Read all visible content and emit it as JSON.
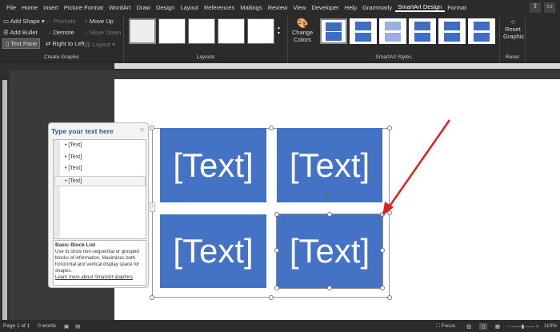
{
  "tabs": [
    "File",
    "Home",
    "Insert",
    "Picture Format",
    "WordArt",
    "Draw",
    "Design",
    "Layout",
    "References",
    "Mailings",
    "Review",
    "View",
    "Developer",
    "Help",
    "Grammarly",
    "SmartArt Design",
    "Format"
  ],
  "active_tab": "SmartArt Design",
  "create_graphic": {
    "label": "Create Graphic",
    "add_shape": "Add Shape",
    "add_bullet": "Add Bullet",
    "text_pane": "Text Pane",
    "promote": "Promote",
    "demote": "Demote",
    "right_to_left": "Right to Left",
    "move_up": "Move Up",
    "move_down": "Move Down",
    "layout": "Layout"
  },
  "layouts": {
    "label": "Layouts"
  },
  "styles": {
    "label": "SmartArt Styles",
    "change_colors": "Change Colors"
  },
  "reset": {
    "label": "Reset",
    "reset_graphic": "Reset Graphic"
  },
  "smartart": {
    "boxes": [
      "[Text]",
      "[Text]",
      "[Text]",
      "[Text]"
    ],
    "color": "#4472c4"
  },
  "text_pane": {
    "title": "Type your text here",
    "items": [
      "[Text]",
      "[Text]",
      "[Text]",
      "[Text]"
    ],
    "layout_name": "Basic Block List",
    "description": "Use to show non-sequential or grouped blocks of information. Maximizes both horizontal and vertical display space for shapes.",
    "link": "Learn more about SmartArt graphics"
  },
  "status": {
    "page": "Page 1 of 1",
    "words": "0 words",
    "focus": "Focus",
    "zoom": "110%"
  }
}
